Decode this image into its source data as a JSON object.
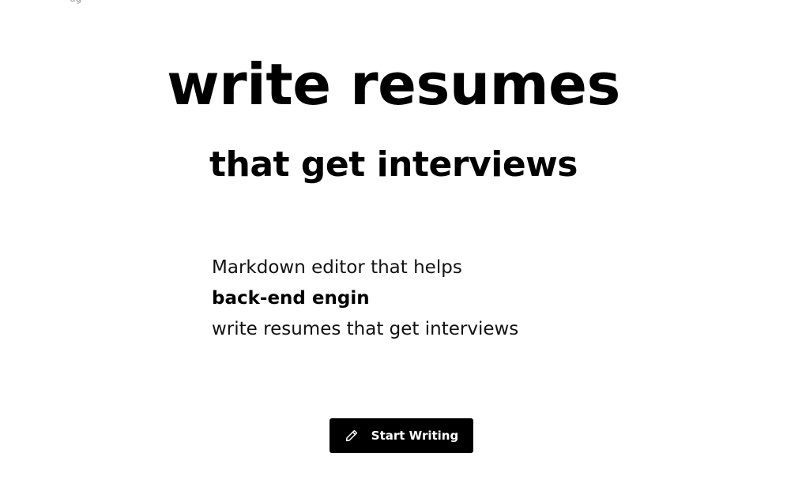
{
  "header": {
    "fragment": "ug"
  },
  "hero": {
    "title": "write resumes",
    "subtitle": "that get interviews"
  },
  "typing": {
    "lines": [
      "Markdown editor that helps",
      "back-end engin",
      "write resumes that get interviews"
    ]
  },
  "cta": {
    "label": "Start Writing",
    "icon": "pencil-icon"
  },
  "colors": {
    "background": "#ffffff",
    "text": "#000000",
    "button_bg": "#000000",
    "button_text": "#ffffff"
  }
}
